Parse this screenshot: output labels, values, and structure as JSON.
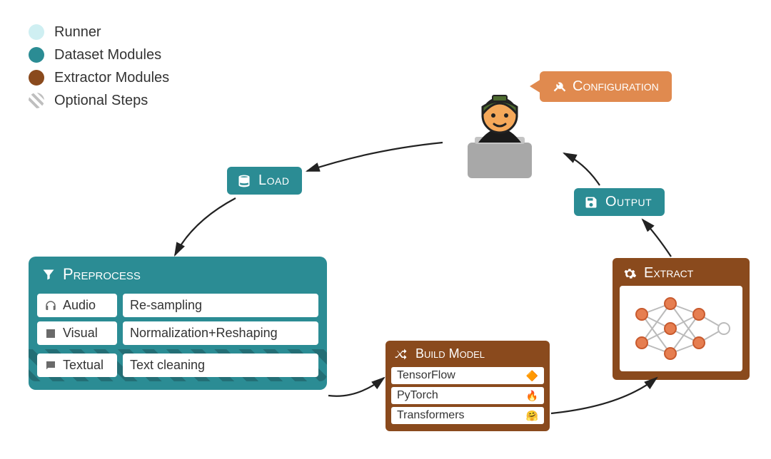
{
  "legend": {
    "runner": "Runner",
    "dataset": "Dataset Modules",
    "extractor": "Extractor Modules",
    "optional": "Optional Steps"
  },
  "flow": {
    "configuration": "Configuration",
    "load": "Load",
    "output": "Output"
  },
  "preprocess": {
    "title": "Preprocess",
    "rows": [
      {
        "mod": "Audio",
        "desc": "Re-sampling",
        "icon": "headphones-icon",
        "optional": false
      },
      {
        "mod": "Visual",
        "desc": "Normalization+Reshaping",
        "icon": "image-icon",
        "optional": false
      },
      {
        "mod": "Textual",
        "desc": "Text cleaning",
        "icon": "chat-icon",
        "optional": true
      }
    ]
  },
  "build_model": {
    "title": "Build Model",
    "items": [
      {
        "label": "TensorFlow",
        "icon": "🔶"
      },
      {
        "label": "PyTorch",
        "icon": "🔥"
      },
      {
        "label": "Transformers",
        "icon": "🤗"
      }
    ]
  },
  "extract": {
    "title": "Extract"
  },
  "colors": {
    "runner": "#cfeff2",
    "dataset": "#2b8c94",
    "extractor": "#8a4a1d",
    "config": "#e08a4f"
  }
}
